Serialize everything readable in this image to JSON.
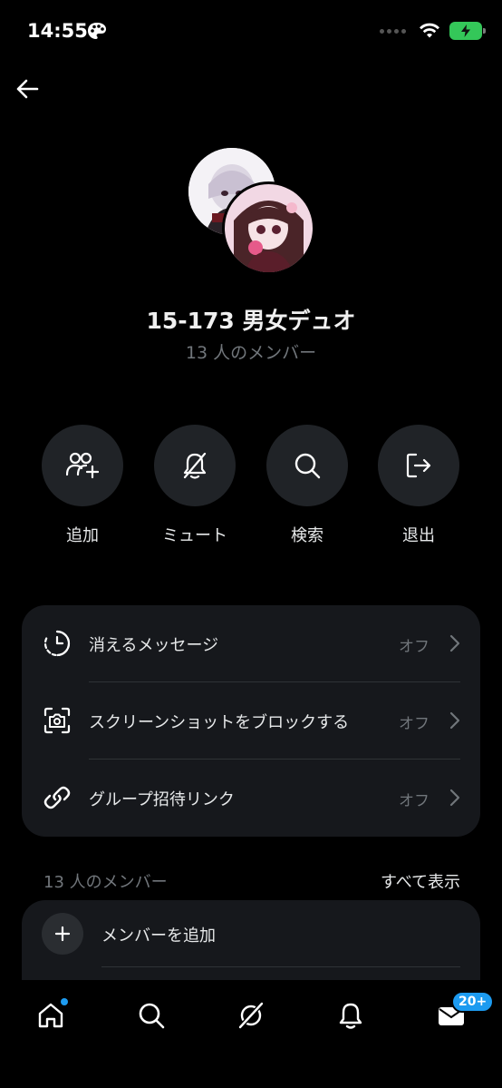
{
  "status_bar": {
    "time": "14:55"
  },
  "group": {
    "title": "15-173 男女デュオ",
    "subtitle": "13 人のメンバー"
  },
  "actions": [
    {
      "label": "追加",
      "icon": "add-people-icon"
    },
    {
      "label": "ミュート",
      "icon": "bell-off-icon"
    },
    {
      "label": "検索",
      "icon": "search-icon"
    },
    {
      "label": "退出",
      "icon": "leave-icon"
    }
  ],
  "settings": [
    {
      "label": "消えるメッセージ",
      "value": "オフ",
      "icon": "timer-icon"
    },
    {
      "label": "スクリーンショットをブロックする",
      "value": "オフ",
      "icon": "screenshot-camera-icon"
    },
    {
      "label": "グループ招待リンク",
      "value": "オフ",
      "icon": "link-icon"
    }
  ],
  "members": {
    "count_label": "13 人のメンバー",
    "show_all": "すべて表示",
    "add_member": "メンバーを追加"
  },
  "bottom_nav": {
    "messages_badge": "20+"
  },
  "colors": {
    "accent": "#1d9bf0",
    "battery": "#34c759",
    "card": "#16181c",
    "circle": "#202327"
  }
}
